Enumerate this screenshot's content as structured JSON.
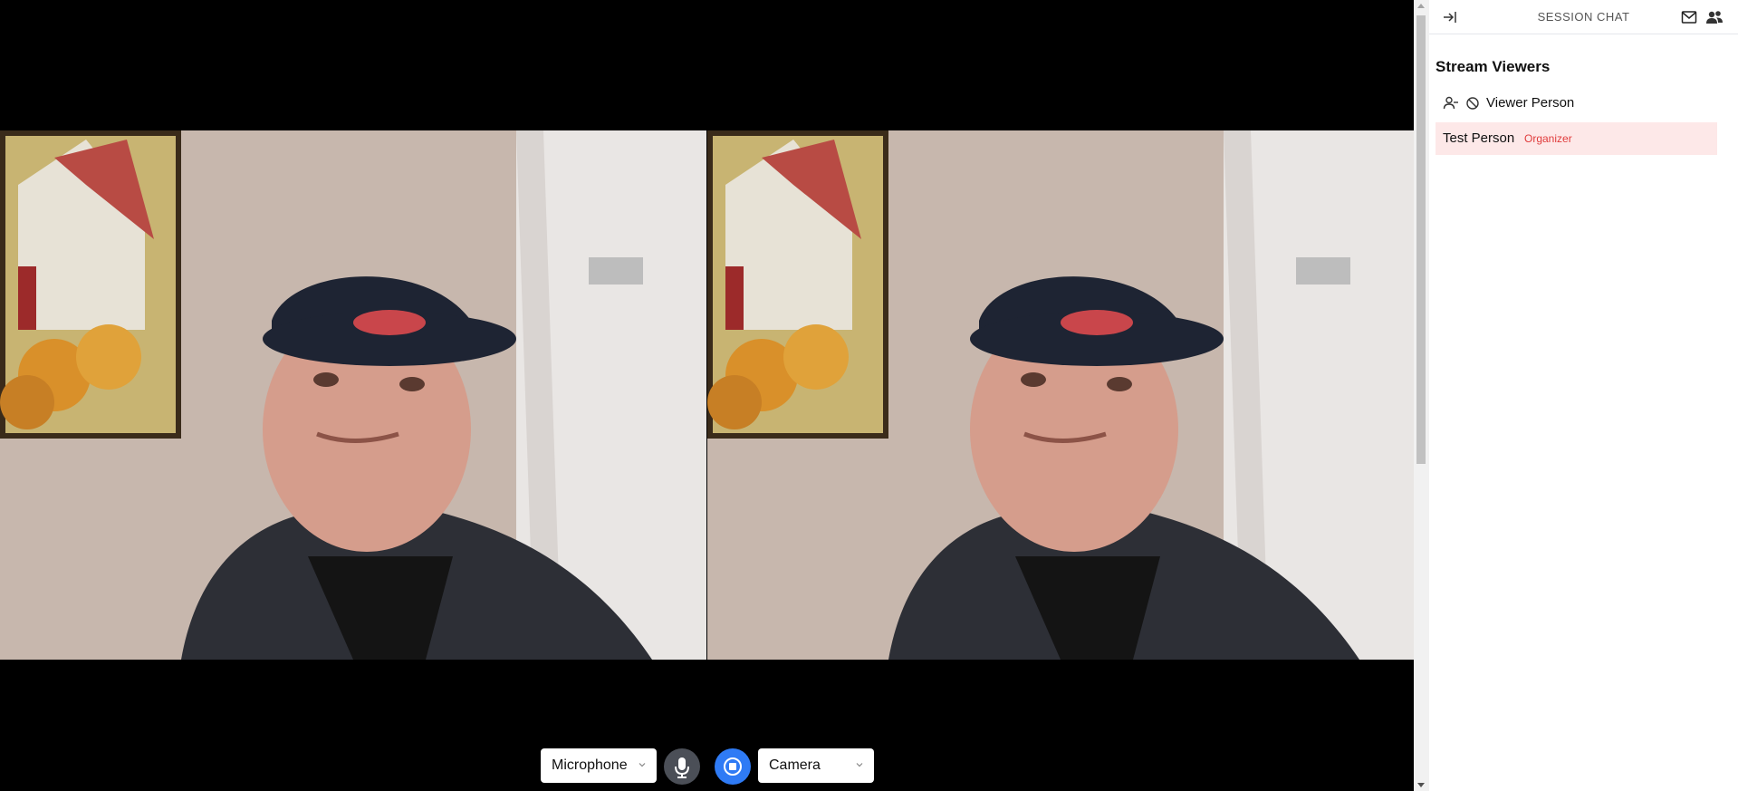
{
  "sidebar": {
    "title": "SESSION CHAT",
    "viewers_heading": "Stream Viewers",
    "viewers": [
      {
        "name": "Viewer Person",
        "badge": ""
      },
      {
        "name": "Test Person",
        "badge": "Organizer"
      }
    ]
  },
  "controls": {
    "microphone_label": "Microphone",
    "camera_label": "Camera"
  },
  "icons": {
    "collapse": "collapse-right-icon",
    "mail": "mail-icon",
    "people": "people-icon",
    "remove_user": "remove-user-icon",
    "ban": "ban-icon",
    "microphone": "microphone-icon",
    "stop": "stop-icon"
  },
  "colors": {
    "accent": "#2f7bf5",
    "organizer_badge": "#e03b3b",
    "organizer_row_bg": "#fde8e8",
    "mic_button": "#4b4f57"
  }
}
